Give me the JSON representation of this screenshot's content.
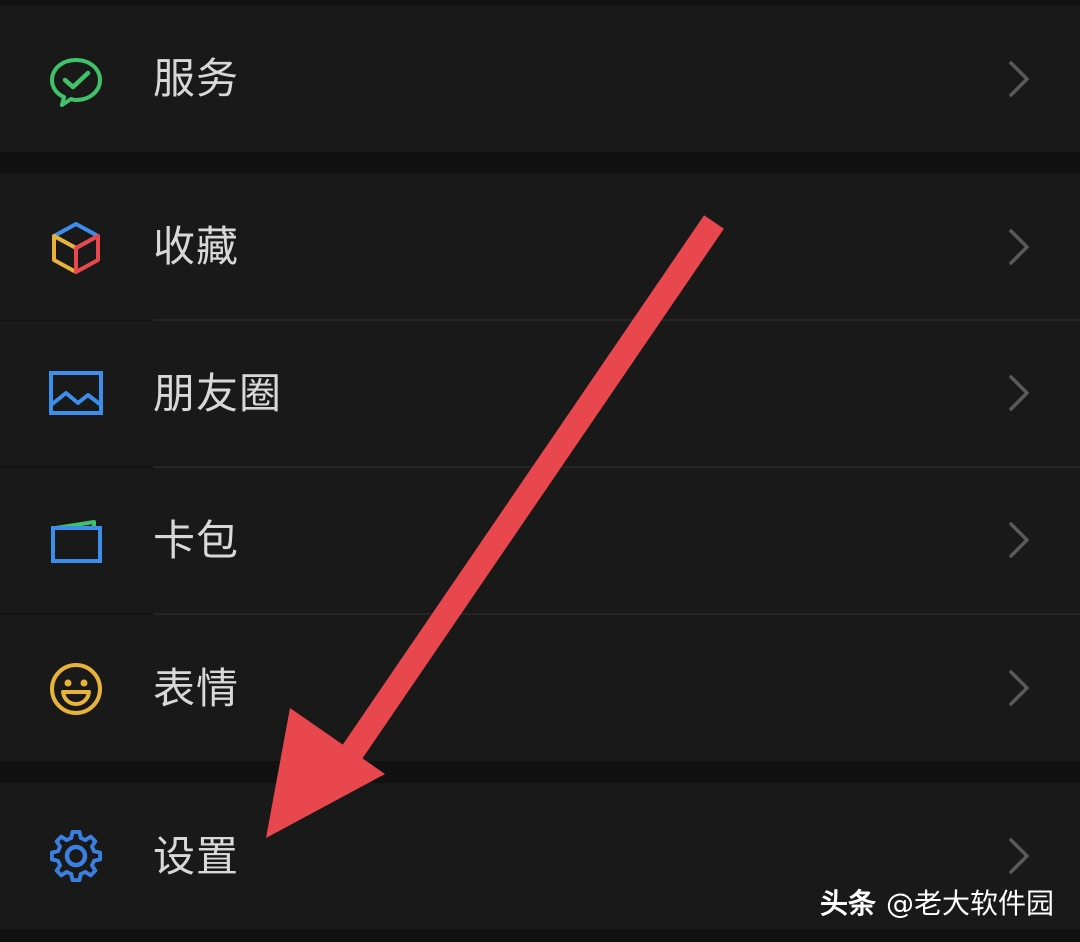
{
  "menu": {
    "services": {
      "label": "服务",
      "icon": "services-icon"
    },
    "favorites": {
      "label": "收藏",
      "icon": "favorites-cube-icon"
    },
    "moments": {
      "label": "朋友圈",
      "icon": "moments-image-icon"
    },
    "cards": {
      "label": "卡包",
      "icon": "card-wallet-icon"
    },
    "stickers": {
      "label": "表情",
      "icon": "smiley-icon"
    },
    "settings": {
      "label": "设置",
      "icon": "gear-icon"
    }
  },
  "watermark": {
    "brand": "头条",
    "account": "@老大软件园"
  },
  "colors": {
    "background": "#111111",
    "row": "#191919",
    "text": "#d8d8d8",
    "chevron": "#5a5a5a",
    "services_green": "#3fc26a",
    "moments_blue": "#3b8eea",
    "stickers_yellow": "#e8b33a",
    "settings_blue": "#3b7fe0",
    "annotation_red": "#e8474d"
  }
}
